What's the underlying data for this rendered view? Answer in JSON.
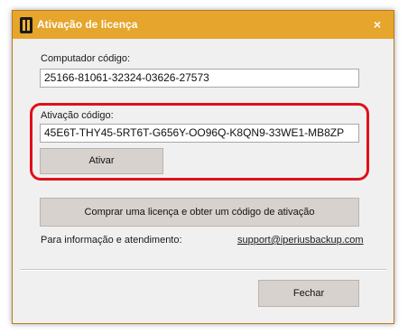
{
  "window": {
    "title": "Ativação de licença",
    "close_glyph": "×",
    "icon": "app-logo-icon"
  },
  "computer_code": {
    "label": "Computador código:",
    "value": "25166-81061-32324-03626-27573"
  },
  "activation_code": {
    "label": "Ativação código:",
    "value": "45E6T-THY45-5RT6T-G656Y-OO96Q-K8QN9-33WE1-MB8ZP"
  },
  "buttons": {
    "activate": "Ativar",
    "buy": "Comprar uma licença e obter um código de ativação",
    "close": "Fechar"
  },
  "info": {
    "label": "Para informação e atendimento:",
    "email": "support@iperiusbackup.com"
  },
  "colors": {
    "titlebar": "#e6a52c",
    "highlight": "#e0101a"
  }
}
